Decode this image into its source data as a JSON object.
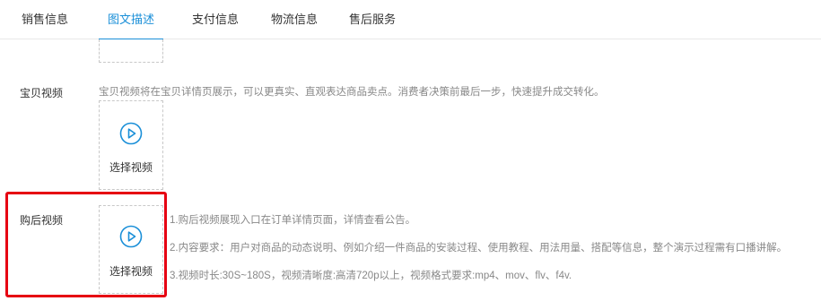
{
  "tabs": [
    {
      "label": "销售信息",
      "active": false
    },
    {
      "label": "图文描述",
      "active": true
    },
    {
      "label": "支付信息",
      "active": false
    },
    {
      "label": "物流信息",
      "active": false
    },
    {
      "label": "售后服务",
      "active": false
    }
  ],
  "video_section": {
    "label": "宝贝视频",
    "description": "宝贝视频将在宝贝详情页展示，可以更真实、直观表达商品卖点。消费者决策前最后一步，快速提升成交转化。",
    "upload_label": "选择视频"
  },
  "after_purchase_section": {
    "label": "购后视频",
    "upload_label": "选择视频",
    "notes": [
      "1.购后视频展现入口在订单详情页面，详情查看公告。",
      "2.内容要求：用户对商品的动态说明、例如介绍一件商品的安装过程、使用教程、用法用量、搭配等信息，整个演示过程需有口播讲解。",
      "3.视频时长:30S~180S，视频清晰度:高清720p以上，视频格式要求:mp4、mov、flv、f4v."
    ]
  },
  "colors": {
    "accent": "#1a8fd8",
    "highlight": "#e60012",
    "muted_text": "#888888"
  },
  "icons": {
    "play": "play-circle-icon"
  }
}
